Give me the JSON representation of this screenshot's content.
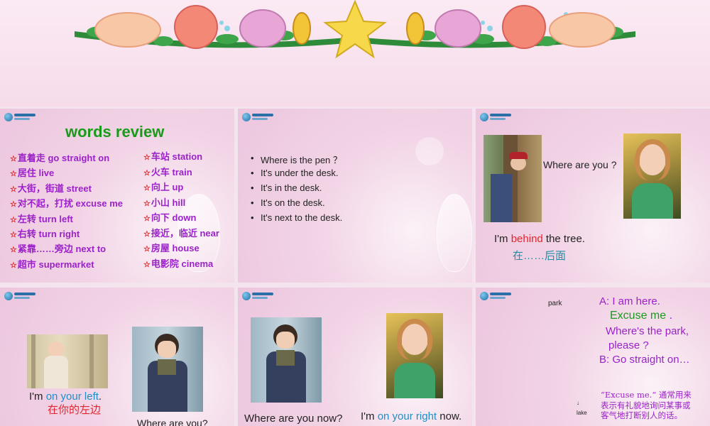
{
  "slide1": {
    "title": "words review",
    "left_items": [
      "直着走 go straight on",
      "居住 live",
      "大街，街道 street",
      "对不起，打扰 excuse me",
      "左转 turn left",
      "右转 turn right",
      "紧靠……旁边 next to",
      "超市 supermarket"
    ],
    "right_items": [
      "车站 station",
      "火车 train",
      "向上 up",
      "小山 hill",
      "向下 down",
      "接近，临近 near",
      "房屋 house",
      "电影院 cinema"
    ],
    "star": "☆"
  },
  "slide2": {
    "bullets": [
      "Where is the  pen ？",
      "It's under the desk.",
      "It's in the desk.",
      "It's on the desk.",
      "It's next to the desk."
    ]
  },
  "slide3": {
    "question": "Where are you ?",
    "answer_pre": "I'm ",
    "answer_key": "behind",
    "answer_post": " the tree.",
    "chinese": "在……后面"
  },
  "slide4": {
    "answer_pre": "I'm ",
    "answer_key": "on your left",
    "answer_post": ".",
    "chinese": "在你的左边",
    "question": "Where are you?"
  },
  "slide5": {
    "question": "Where are you now?",
    "answer_pre": "I'm ",
    "answer_key": "on your right",
    "answer_post": " now."
  },
  "slide6": {
    "map_park": "park",
    "map_lake": "lake",
    "line_a1": "A: I am here.",
    "line_excuse": "Excuse me",
    "line_excuse_dot": " .",
    "line_where": "Where's the park,",
    "line_please": "please ?",
    "line_b": "B: Go straight on…",
    "note": "“Excuse me.“ 通常用来表示有礼貌地询问某事或客气地打断别人的话。"
  },
  "colors": {
    "purple": "#9b22c8",
    "green": "#1a9a1a",
    "red": "#e0252f",
    "teal": "#1f8fa8",
    "blue": "#1f8fc8"
  }
}
